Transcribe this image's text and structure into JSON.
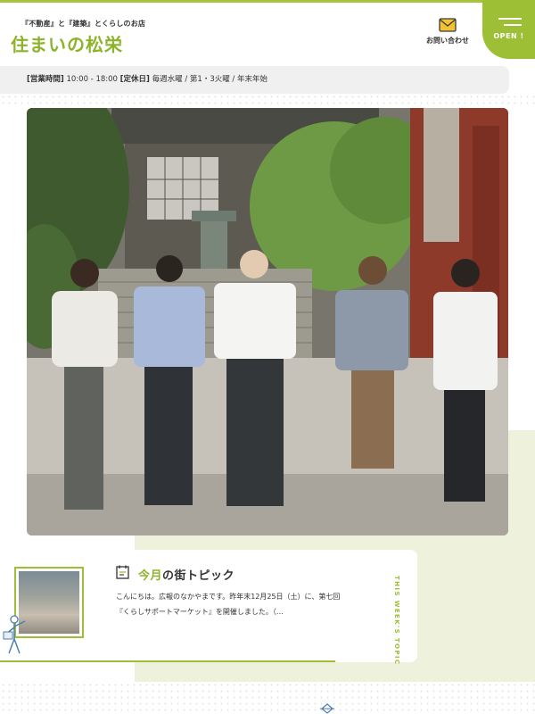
{
  "header": {
    "tagline": "『不動産』と『建築』とくらしのお店",
    "logo_text": "住まいの松栄",
    "contact_label": "お問い合わせ",
    "menu_label": "OPEN !"
  },
  "hours": {
    "label_time": "[営業時間]",
    "time": " 10:00 - 18:00 ",
    "label_closed": "[定休日]",
    "closed": " 毎週水曜 / 第1・3火曜 / 年末年始"
  },
  "topic": {
    "title_accent": "今月",
    "title_rest": "の街トピック",
    "body": "こんにちは。広報のなかやまです。昨年末12月25日（土）に、第七回『くらしサポートマーケット』を開催しました。（…",
    "vertical_label": "THIS WEEK'S TOPIC"
  },
  "colors": {
    "accent": "#9dbf35",
    "logo_green": "#8db32b",
    "panel_tint": "#eef2dc"
  },
  "icons": [
    "mail-icon",
    "hamburger-icon",
    "clipboard-icon",
    "guide-figure-icon",
    "ornament-icon"
  ]
}
